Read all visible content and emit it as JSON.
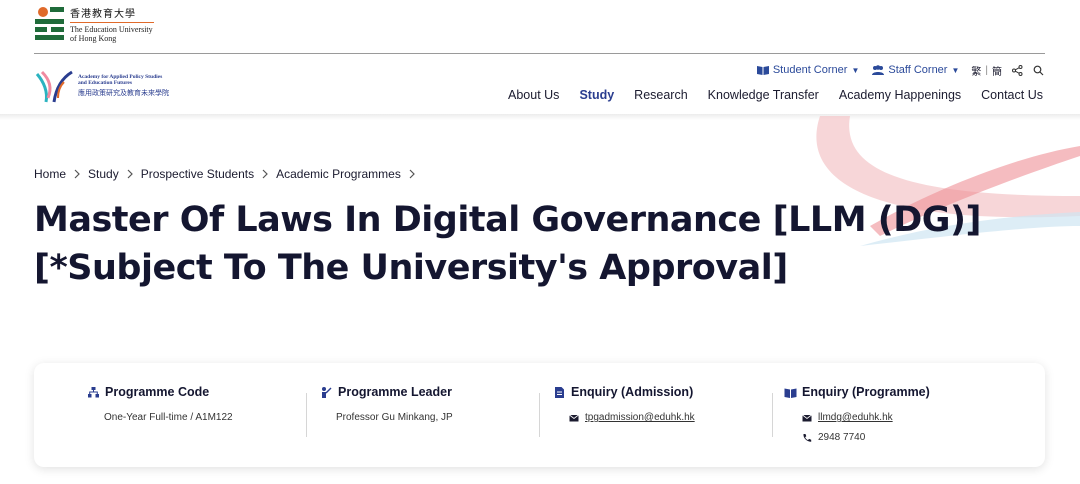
{
  "university": {
    "name_cn": "香港教育大學",
    "name_en_line1": "The Education University",
    "name_en_line2": "of Hong Kong"
  },
  "academy": {
    "name_en_line1": "Academy for Applied Policy Studies",
    "name_en_line2": "and Education Futures",
    "name_cn": "應用政策研究及教育未來學院"
  },
  "utility": {
    "student_corner": "Student Corner",
    "staff_corner": "Staff Corner",
    "lang_trad": "繁",
    "lang_simp": "簡",
    "separator": "|",
    "caret": "▼"
  },
  "nav": {
    "items": [
      {
        "label": "About Us"
      },
      {
        "label": "Study"
      },
      {
        "label": "Research"
      },
      {
        "label": "Knowledge Transfer"
      },
      {
        "label": "Academy Happenings"
      },
      {
        "label": "Contact Us"
      }
    ],
    "active": "Study"
  },
  "breadcrumb": {
    "items": [
      "Home",
      "Study",
      "Prospective Students",
      "Academic Programmes"
    ]
  },
  "page": {
    "title": "Master Of Laws In Digital Governance [LLM (DG)] [*Subject To The University's Approval]"
  },
  "info": {
    "code": {
      "heading": "Programme Code",
      "value": "One-Year Full-time / A1M122"
    },
    "leader": {
      "heading": "Programme Leader",
      "value": "Professor Gu Minkang, JP"
    },
    "admission": {
      "heading": "Enquiry (Admission)",
      "email": "tpgadmission@eduhk.hk"
    },
    "programme": {
      "heading": "Enquiry (Programme)",
      "email": "llmdg@eduhk.hk",
      "phone": "2948 7740"
    }
  },
  "colors": {
    "accent": "#2a3d8f",
    "title": "#141630",
    "brand_orange": "#e06a2a",
    "brand_green": "#1f6b3a"
  }
}
